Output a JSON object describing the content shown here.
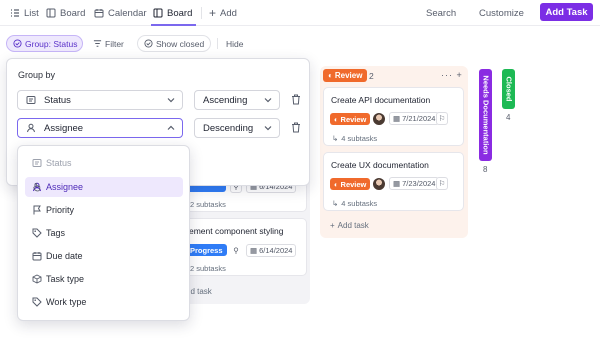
{
  "nav": {
    "tabs": [
      {
        "label": "List",
        "icon": "list-icon",
        "active": false
      },
      {
        "label": "Board",
        "icon": "board-icon",
        "active": false
      },
      {
        "label": "Calendar",
        "icon": "calendar-icon",
        "active": false
      },
      {
        "label": "Board",
        "icon": "board-icon",
        "active": true
      }
    ],
    "add_label": "Add",
    "search_label": "Search",
    "customize_label": "Customize",
    "add_task_label": "Add Task"
  },
  "toolbar": {
    "group_label": "Group: Status",
    "filter_label": "Filter",
    "show_closed_label": "Show closed",
    "hide_label": "Hide"
  },
  "group_by": {
    "title": "Group by",
    "rows": [
      {
        "field": "Status",
        "field_icon": "status-icon",
        "direction": "Ascending"
      },
      {
        "field": "Assignee",
        "field_icon": "user-icon",
        "direction": "Descending"
      }
    ]
  },
  "field_options": [
    {
      "label": "Status",
      "icon": "status-icon",
      "state": "disabled"
    },
    {
      "label": "Assignee",
      "icon": "user-icon",
      "state": "selected"
    },
    {
      "label": "Priority",
      "icon": "flag-icon",
      "state": "normal"
    },
    {
      "label": "Tags",
      "icon": "tag-icon",
      "state": "normal"
    },
    {
      "label": "Due date",
      "icon": "calendar-icon",
      "state": "normal"
    },
    {
      "label": "Task type",
      "icon": "cube-icon",
      "state": "normal"
    },
    {
      "label": "Work type",
      "icon": "tag-icon",
      "state": "normal"
    }
  ],
  "board": {
    "left_column": {
      "cards": [
        {
          "date": "6/14/2024",
          "subtasks": "2 subtasks"
        },
        {
          "title": "ement component styling",
          "status": "Progress",
          "date": "6/14/2024",
          "subtasks": "2 subtasks"
        }
      ],
      "add_task_label": "dd task"
    },
    "review_column": {
      "status": "Review",
      "count": "2",
      "cards": [
        {
          "title": "Create API documentation",
          "status": "Review",
          "date": "7/21/2024",
          "subtasks": "4 subtasks"
        },
        {
          "title": "Create UX documentation",
          "status": "Review",
          "date": "7/23/2024",
          "subtasks": "4 subtasks"
        }
      ],
      "add_task_label": "Add task"
    },
    "collapsed_columns": [
      {
        "label": "Needs Documentation",
        "count": "8",
        "color": "#8a2be2"
      },
      {
        "label": "Closed",
        "count": "4",
        "color": "#1db954"
      }
    ]
  },
  "colors": {
    "accent": "#7b2ee5",
    "review": "#f06a2c",
    "progress": "#2f7cf6"
  }
}
